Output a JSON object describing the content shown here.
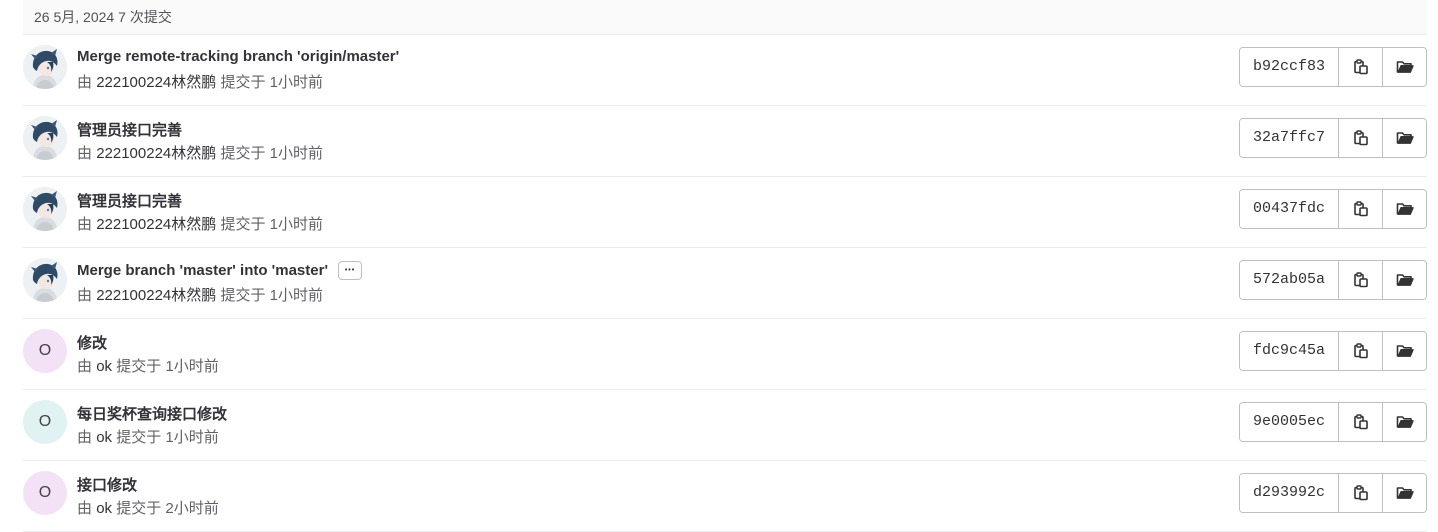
{
  "day_header": {
    "date": "26 5月, 2024",
    "count": "7 次提交"
  },
  "commits": [
    {
      "title": "Merge remote-tracking branch 'origin/master'",
      "by": "由",
      "author": "222100224林然鹏",
      "committed": "提交于",
      "time": "1小时前",
      "sha": "b92ccf83",
      "avatar": "anime",
      "avatar_letter": "",
      "has_ellipsis": false
    },
    {
      "title": "管理员接口完善",
      "by": "由",
      "author": "222100224林然鹏",
      "committed": "提交于",
      "time": "1小时前",
      "sha": "32a7ffc7",
      "avatar": "anime",
      "avatar_letter": "",
      "has_ellipsis": false
    },
    {
      "title": "管理员接口完善",
      "by": "由",
      "author": "222100224林然鹏",
      "committed": "提交于",
      "time": "1小时前",
      "sha": "00437fdc",
      "avatar": "anime",
      "avatar_letter": "",
      "has_ellipsis": false
    },
    {
      "title": "Merge branch 'master' into 'master'",
      "by": "由",
      "author": "222100224林然鹏",
      "committed": "提交于",
      "time": "1小时前",
      "sha": "572ab05a",
      "avatar": "anime",
      "avatar_letter": "",
      "has_ellipsis": true
    },
    {
      "title": "修改",
      "by": "由",
      "author": "ok",
      "committed": "提交于",
      "time": "1小时前",
      "sha": "fdc9c45a",
      "avatar": "purple",
      "avatar_letter": "O",
      "has_ellipsis": false
    },
    {
      "title": "每日奖杯查询接口修改",
      "by": "由",
      "author": "ok",
      "committed": "提交于",
      "time": "1小时前",
      "sha": "9e0005ec",
      "avatar": "cyan",
      "avatar_letter": "O",
      "has_ellipsis": false
    },
    {
      "title": "接口修改",
      "by": "由",
      "author": "ok",
      "committed": "提交于",
      "time": "2小时前",
      "sha": "d293992c",
      "avatar": "purple",
      "avatar_letter": "O",
      "has_ellipsis": false
    }
  ],
  "icons": {
    "copy": "copy-icon",
    "browse": "folder-open-icon",
    "ellipsis": "ellipsis-icon"
  },
  "colors": {
    "header_bg": "#fafafa",
    "border": "#bfbfc3",
    "avatar_purple": "#f3e2f6",
    "avatar_cyan": "#e0f2f1"
  }
}
